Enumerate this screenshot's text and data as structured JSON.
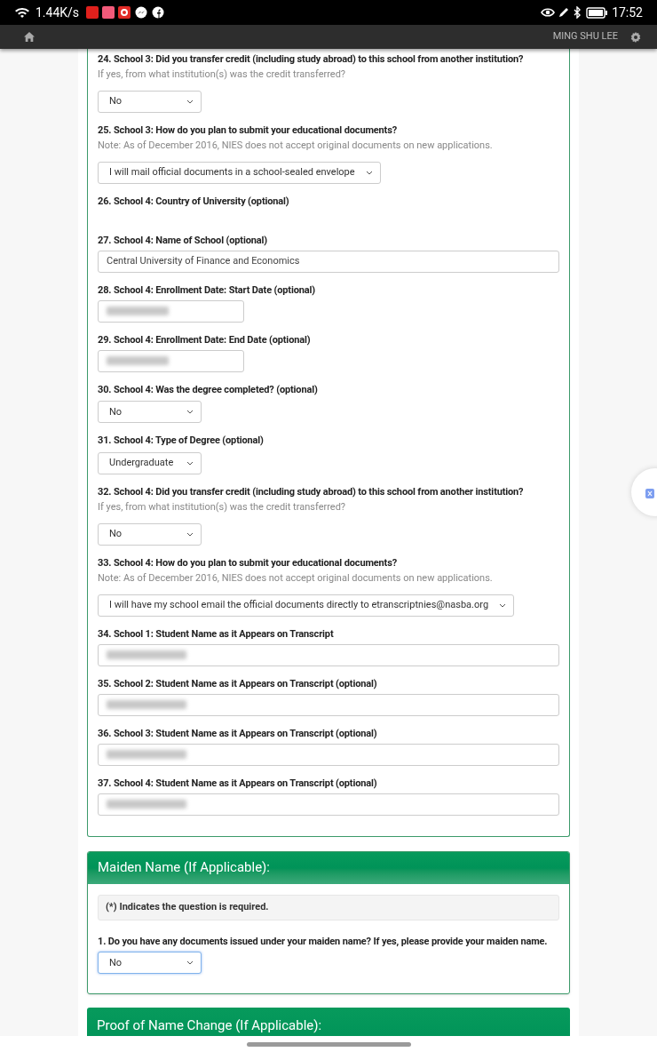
{
  "status_bar": {
    "speed": "1.44K/s",
    "time": "17:52"
  },
  "nav": {
    "user": "MING SHU LEE"
  },
  "education_questions": [
    {
      "label": "24. School 3: Did you transfer credit (including study abroad) to this school from another institution?",
      "hint": "If yes, from what institution(s) was the credit transferred?",
      "field": {
        "kind": "select",
        "value": "No"
      }
    },
    {
      "label": "25. School 3: How do you plan to submit your educational documents?",
      "hint": "Note: As of December 2016, NIES does not accept original documents on new applications.",
      "field": {
        "kind": "select",
        "value": "I will mail official documents in a school-sealed envelope"
      }
    },
    {
      "label": "26. School 4: Country of University (optional)",
      "field": {
        "kind": "empty"
      }
    },
    {
      "label": "27. School 4: Name of School (optional)",
      "field": {
        "kind": "text",
        "value": "Central University of Finance and Economics"
      }
    },
    {
      "label": "28. School 4: Enrollment Date: Start Date (optional)",
      "field": {
        "kind": "date-redacted"
      }
    },
    {
      "label": "29. School 4: Enrollment Date: End Date (optional)",
      "field": {
        "kind": "date-redacted"
      }
    },
    {
      "label": "30. School 4: Was the degree completed? (optional)",
      "field": {
        "kind": "select",
        "value": "No"
      }
    },
    {
      "label": "31. School 4: Type of Degree (optional)",
      "field": {
        "kind": "select",
        "value": "Undergraduate"
      }
    },
    {
      "label": "32. School 4: Did you transfer credit (including study abroad) to this school from another institution?",
      "hint": "If yes, from what institution(s) was the credit transferred?",
      "field": {
        "kind": "select",
        "value": "No"
      }
    },
    {
      "label": "33. School 4: How do you plan to submit your educational documents?",
      "hint": "Note: As of December 2016, NIES does not accept original documents on new applications.",
      "field": {
        "kind": "select",
        "value": "I will have my school email the official documents directly to etranscriptnies@nasba.org"
      }
    },
    {
      "label": "34. School 1: Student Name as it Appears on Transcript",
      "field": {
        "kind": "text-redacted"
      }
    },
    {
      "label": "35. School 2: Student Name as it Appears on Transcript (optional)",
      "field": {
        "kind": "text-redacted"
      }
    },
    {
      "label": "36. School 3: Student Name as it Appears on Transcript (optional)",
      "field": {
        "kind": "text-redacted"
      }
    },
    {
      "label": "37. School 4: Student Name as it Appears on Transcript (optional)",
      "field": {
        "kind": "text-redacted"
      }
    }
  ],
  "maiden_section": {
    "title": "Maiden Name (If Applicable):",
    "note": "(*) Indicates the question is required.",
    "questions": [
      {
        "label": "1. Do you have any documents issued under your maiden name? If yes, please provide your maiden name.",
        "field": {
          "kind": "select",
          "value": "No",
          "focused": true
        }
      }
    ]
  },
  "next_section": {
    "title": "Proof of Name Change (If Applicable):"
  }
}
